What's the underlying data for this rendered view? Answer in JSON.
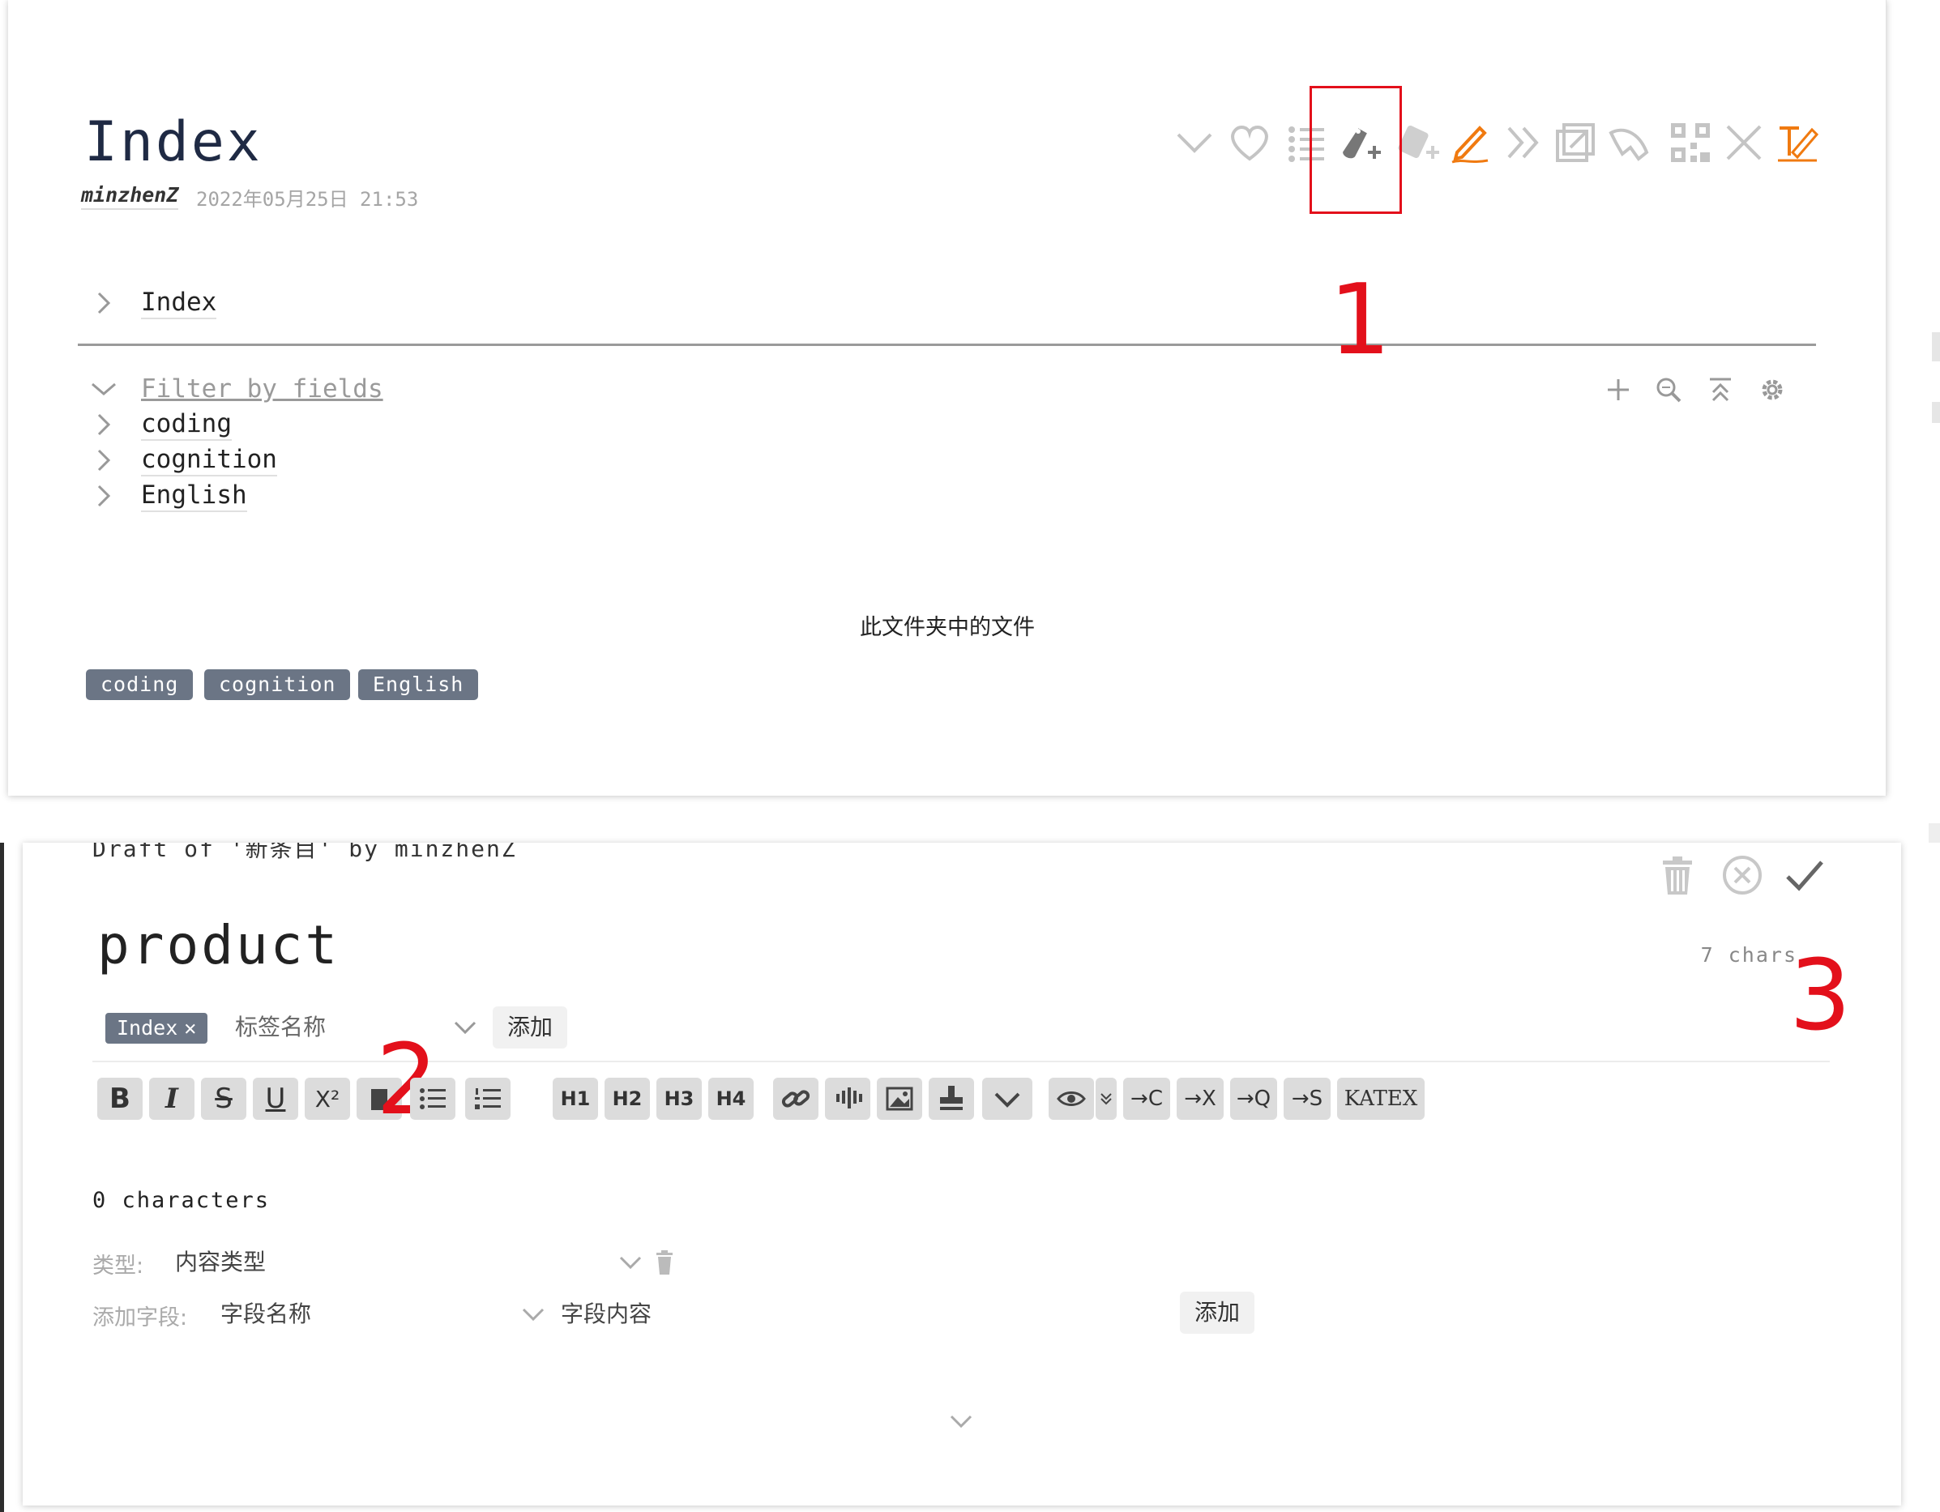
{
  "top_tiddler": {
    "title": "Index",
    "author": "minzhenZ",
    "date": "2022年05月25日 21:53",
    "toolbar_icons": [
      "chevron-down-icon",
      "heart-icon",
      "list-icon",
      "tag-plus-icon",
      "new-tag-icon",
      "edit-pencil-icon",
      "double-chevron-icon",
      "open-external-icon",
      "shell-icon",
      "qr-code-icon",
      "close-icon",
      "edit-text-icon"
    ],
    "tree_root": "Index",
    "filter_label": "Filter by fields",
    "tree_items": [
      "coding",
      "cognition",
      "English"
    ],
    "folder_caption": "此文件夹中的文件",
    "tags": [
      "coding",
      "cognition",
      "English"
    ],
    "accent_color": "#f07a10",
    "tag_bg_color": "#6b7585"
  },
  "annotations": {
    "n1": "1",
    "n2": "2",
    "n3": "3",
    "color": "#e3101b"
  },
  "editor": {
    "draft_label": "Draft of '新条目' by minzhenZ",
    "title_value": "product",
    "title_char_count": "7 chars",
    "tag_chip": "Index",
    "tag_chip_remove": "✕",
    "tag_placeholder": "标签名称",
    "tag_add_button": "添加",
    "toolbar": {
      "bold": "B",
      "italic": "I",
      "strike": "S",
      "underline": "U",
      "superscript": "X²",
      "h1": "H1",
      "h2": "H2",
      "h3": "H3",
      "h4": "H4",
      "katex": "KATEX",
      "excise": "C",
      "transclude": "X",
      "quote": "Q",
      "stamp": "S"
    },
    "body_char_count": "0 characters",
    "type_label": "类型:",
    "type_placeholder": "内容类型",
    "field_label": "添加字段:",
    "field_name_placeholder": "字段名称",
    "field_value_placeholder": "字段内容",
    "field_add_button": "添加"
  }
}
